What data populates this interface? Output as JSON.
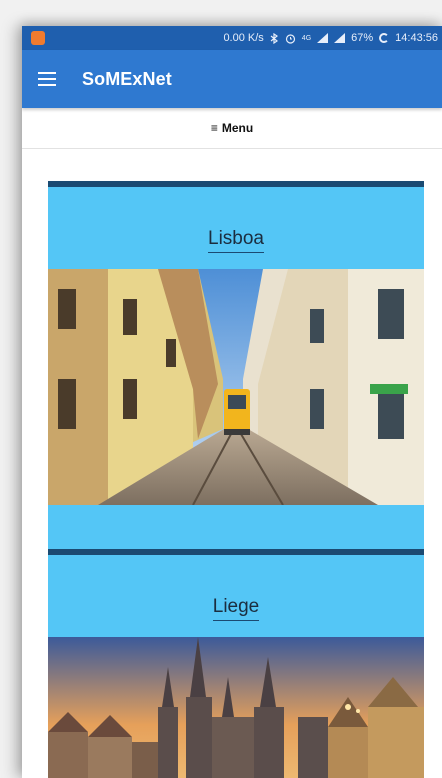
{
  "status_bar": {
    "speed": "0.00 K/s",
    "bluetooth_icon": "bluetooth-icon",
    "alarm_icon": "alarm-icon",
    "network": "4G",
    "signal_icon": "signal-icon",
    "battery": "67%",
    "time": "14:43:56"
  },
  "app_bar": {
    "title": "SoMExNet",
    "menu_icon": "hamburger-icon"
  },
  "menu": {
    "label": "Menu",
    "icon": "≡"
  },
  "cities": [
    {
      "name": "Lisboa",
      "image": "lisbon-tram-street-photo"
    },
    {
      "name": "Liege",
      "image": "liege-city-skyline-photo"
    }
  ],
  "colors": {
    "status_bar": "#1f5fae",
    "app_bar": "#2f79d0",
    "card": "#54c6f6",
    "card_border": "#1b4a72"
  }
}
